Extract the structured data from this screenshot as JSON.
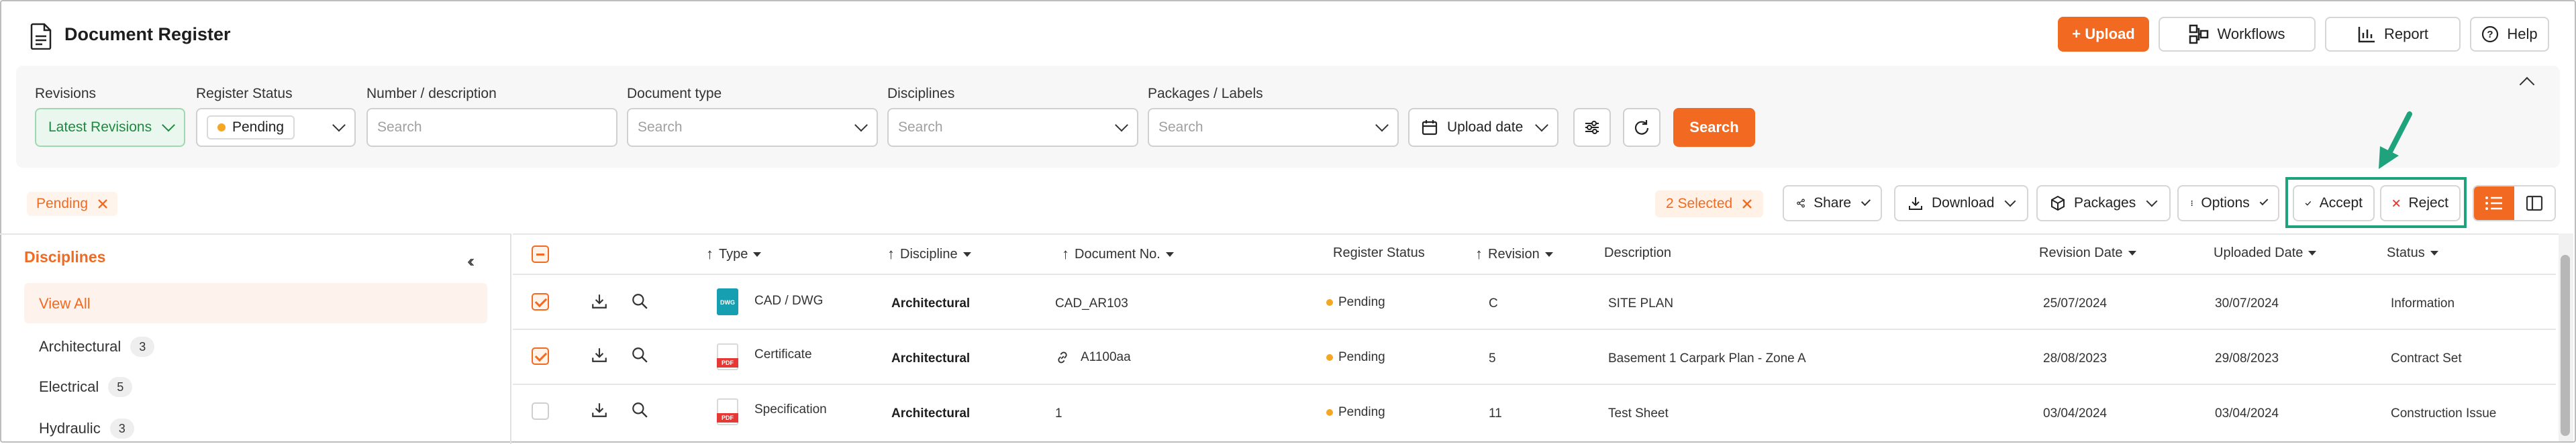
{
  "header": {
    "title": "Document Register",
    "upload_label": "+ Upload",
    "workflows_label": "Workflows",
    "report_label": "Report",
    "help_label": "Help"
  },
  "filters": {
    "revisions": {
      "label": "Revisions",
      "value": "Latest Revisions"
    },
    "register_status": {
      "label": "Register Status",
      "value": "Pending"
    },
    "number_description": {
      "label": "Number / description",
      "placeholder": "Search"
    },
    "document_type": {
      "label": "Document type",
      "placeholder": "Search"
    },
    "disciplines": {
      "label": "Disciplines",
      "placeholder": "Search"
    },
    "packages_labels": {
      "label": "Packages / Labels",
      "placeholder": "Search"
    },
    "upload_date_label": "Upload date",
    "search_label": "Search"
  },
  "toolbar": {
    "active_filter": "Pending",
    "selected_count": "2 Selected",
    "share_label": "Share",
    "download_label": "Download",
    "packages_label": "Packages",
    "options_label": "Options",
    "accept_label": "Accept",
    "reject_label": "Reject"
  },
  "sidebar": {
    "title": "Disciplines",
    "items": [
      {
        "label": "View All",
        "count": ""
      },
      {
        "label": "Architectural",
        "count": "3"
      },
      {
        "label": "Electrical",
        "count": "5"
      },
      {
        "label": "Hydraulic",
        "count": "3"
      }
    ]
  },
  "table": {
    "columns": {
      "type": "Type",
      "discipline": "Discipline",
      "document_no": "Document No.",
      "register_status": "Register Status",
      "revision": "Revision",
      "description": "Description",
      "revision_date": "Revision Date",
      "uploaded_date": "Uploaded Date",
      "status": "Status"
    },
    "rows": [
      {
        "checked": true,
        "type": "CAD / DWG",
        "icon_text": "DWG",
        "discipline": "Architectural",
        "document_no": "CAD_AR103",
        "register_status": "Pending",
        "revision": "C",
        "description": "SITE PLAN",
        "revision_date": "25/07/2024",
        "uploaded_date": "30/07/2024",
        "status": "Information"
      },
      {
        "checked": true,
        "type": "Certificate",
        "icon_text": "PDF",
        "discipline": "Architectural",
        "document_no": "A1100aa",
        "register_status": "Pending",
        "revision": "5",
        "description": "Basement 1 Carpark Plan - Zone A",
        "revision_date": "28/08/2023",
        "uploaded_date": "29/08/2023",
        "status": "Contract Set"
      },
      {
        "checked": false,
        "type": "Specification",
        "icon_text": "PDF",
        "discipline": "Architectural",
        "document_no": "1",
        "register_status": "Pending",
        "revision": "11",
        "description": "Test Sheet",
        "revision_date": "03/04/2024",
        "uploaded_date": "03/04/2024",
        "status": "Construction Issue"
      }
    ]
  },
  "colors": {
    "accent": "#f26a21",
    "highlight": "#1fa37c",
    "pending": "#f5a623"
  }
}
